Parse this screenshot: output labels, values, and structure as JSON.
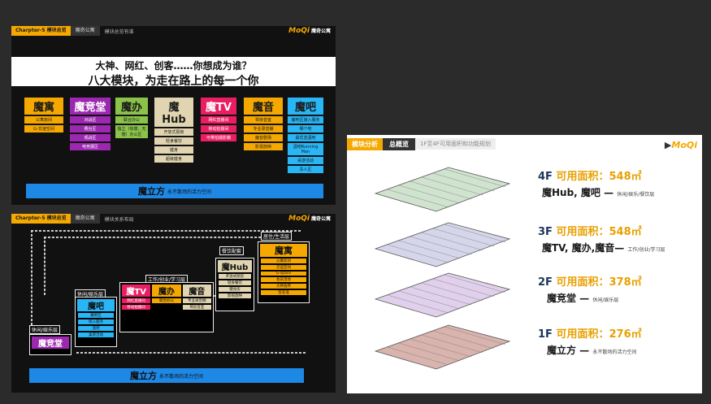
{
  "slide1": {
    "chapter": "Charpter-5 模块总览",
    "section": "魔奇公寓",
    "subtitle": "模块总览有谁",
    "logo_brand": "MoQi",
    "logo_suffix": "魔奇公寓",
    "headline1": "大神、网红、创客……你想成为谁？",
    "headline2": "八大模块，为走在路上的每一个你",
    "modules": [
      {
        "name": "魔寓",
        "color": "#f5a800",
        "text_color": "#1a1a1a",
        "items": [
          "公寓房间",
          "G-交谊空间"
        ]
      },
      {
        "name": "魔竞堂",
        "color": "#9c27b0",
        "text_color": "#ffffff",
        "items": [
          "对战区",
          "赛台区",
          "观战区",
          "电竞展区"
        ]
      },
      {
        "name": "魔办",
        "color": "#8bc34a",
        "text_color": "#1a1a1a",
        "items": [
          "联合办公",
          "独立（有偿、无偿）办公区"
        ]
      },
      {
        "name": "魔Hub",
        "color": "#e0d5b0",
        "text_color": "#1a1a1a",
        "items": [
          "开放式厨房",
          "轻食餐饮",
          "健身",
          "超级健身"
        ]
      },
      {
        "name": "魔TV",
        "color": "#e91e63",
        "text_color": "#ffffff",
        "items": [
          "网红直播间",
          "移动拍摄间",
          "可带拍摄影棚"
        ]
      },
      {
        "name": "魔音",
        "color": "#f5a800",
        "text_color": "#1a1a1a",
        "items": [
          "琴房音室",
          "专业录音棚",
          "魔音剧场",
          "影视放映"
        ]
      },
      {
        "name": "魔吧",
        "color": "#29b6f6",
        "text_color": "#1a1a1a",
        "items": [
          "魔吧区接入服务",
          "哪个吧",
          "最优选酒吧",
          "酒吧Running Man",
          "桌游活动",
          "青人区"
        ]
      }
    ],
    "bottom_title": "魔立方",
    "bottom_sub": "永不散场的活力空间"
  },
  "slide2": {
    "chapter": "Charpter-5 模块总览",
    "section": "魔奇公寓",
    "subtitle": "模块关系布局",
    "logo_brand": "MoQi",
    "logo_suffix": "魔奇公寓",
    "layer_labels": {
      "living": "居住/生活层",
      "dining": "餐饮配套",
      "work": "工作/创业/学习层",
      "leisure1": "休闲/娱乐层",
      "leisure2": "休闲/娱乐层"
    },
    "block_moyu": "魔寓",
    "block_hub": "魔Hub",
    "block_tv": "魔TV",
    "block_ban": "魔办",
    "block_yin": "魔音",
    "block_ba": "魔吧",
    "block_jingtang": "魔竞堂",
    "moyu_items": [
      "公寓房间",
      "交谊空间",
      "G-space",
      "会员活动",
      "大神会所",
      "签名墙"
    ],
    "hub_items": [
      "开放式厨房",
      "轻食餐饮",
      "健身房",
      "影视放映"
    ],
    "tv_items": [
      "网红直播间",
      "移动拍摄间"
    ],
    "ban_items": [
      "联合办公"
    ],
    "yin_items": [
      "专业录音棚",
      "琴房音室"
    ],
    "ba_items": [
      "魔吧区",
      "接入服务",
      "酒吧",
      "桌游活动"
    ],
    "bottom_title": "魔立方",
    "bottom_sub": "永不散场的活力空间"
  },
  "slide3": {
    "tab1": "模块分析",
    "tab2": "总概览",
    "subtitle": "1F至4F可用面积和功能规划",
    "logo_brand": "MoQi",
    "floors": [
      {
        "floor": "4F",
        "label": "可用面积：",
        "area": "548㎡",
        "mods": "魔Hub, 魔吧 —",
        "desc": "休闲/娱乐/餐饮层",
        "color": "#cfe3cf"
      },
      {
        "floor": "3F",
        "label": "可用面积：",
        "area": "548㎡",
        "mods": "魔TV, 魔办,魔音—",
        "desc": "工作/创业/学习层",
        "color": "#d6d6ea"
      },
      {
        "floor": "2F",
        "label": "可用面积：",
        "area": "378㎡",
        "mods": "魔竞堂 —",
        "desc": "休闲/娱乐层",
        "color": "#e0d0ec"
      },
      {
        "floor": "1F",
        "label": "可用面积：",
        "area": "276㎡",
        "mods": "魔立方 —",
        "desc": "永不散场的活力空间",
        "color": "#d9b3ad"
      }
    ]
  }
}
